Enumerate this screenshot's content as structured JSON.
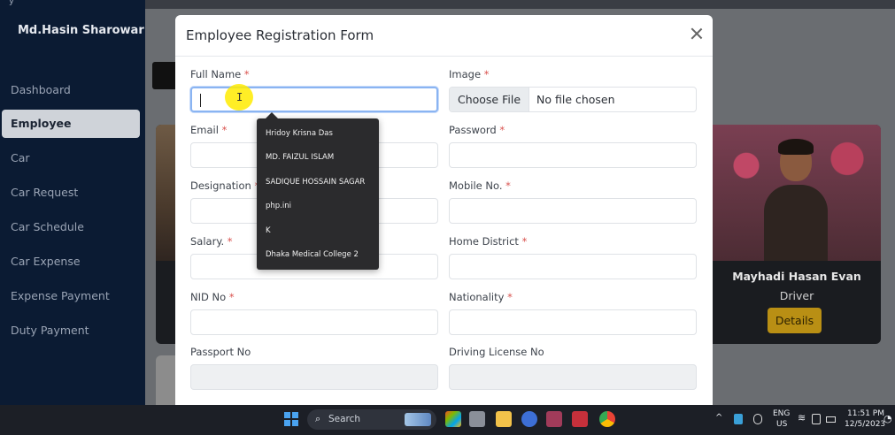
{
  "sidebar": {
    "user_name": "Md.Hasin Sharowar",
    "top_glyph": "y",
    "items": [
      {
        "label": "Dashboard"
      },
      {
        "label": "Employee"
      },
      {
        "label": "Car"
      },
      {
        "label": "Car Request"
      },
      {
        "label": "Car Schedule"
      },
      {
        "label": "Car Expense"
      },
      {
        "label": "Expense Payment"
      },
      {
        "label": "Duty Payment"
      }
    ],
    "active_item": "Employee"
  },
  "background_card": {
    "name": "Mayhadi Hasan Evan",
    "role": "Driver",
    "details_label": "Details"
  },
  "modal": {
    "title": "Employee Registration Form",
    "fields": {
      "full_name": {
        "label": "Full Name",
        "required": "*",
        "value": ""
      },
      "image": {
        "label": "Image",
        "required": "*",
        "button": "Choose File",
        "status": "No file chosen"
      },
      "email": {
        "label": "Email",
        "required": "*"
      },
      "password": {
        "label": "Password",
        "required": "*"
      },
      "designation": {
        "label": "Designation",
        "required": "*"
      },
      "mobile": {
        "label": "Mobile No.",
        "required": "*"
      },
      "salary": {
        "label": "Salary.",
        "required": "*"
      },
      "home_district": {
        "label": "Home District",
        "required": "*"
      },
      "nid": {
        "label": "NID No",
        "required": "*"
      },
      "nationality": {
        "label": "Nationality",
        "required": "*"
      },
      "passport": {
        "label": "Passport No"
      },
      "driving_license": {
        "label": "Driving License No"
      }
    }
  },
  "autocomplete": {
    "items": [
      "Hridoy Krisna Das",
      "MD. FAIZUL ISLAM",
      "SADIQUE HOSSAIN SAGAR",
      "php.ini",
      "K",
      "Dhaka Medical College 2"
    ]
  },
  "taskbar": {
    "search_label": "Search",
    "lang_line1": "ENG",
    "lang_line2": "US",
    "time": "11:51 PM",
    "date": "12/5/2023"
  },
  "colors": {
    "sidebar_bg": "#0b1b33",
    "details_button": "#b98f14",
    "required_mark": "#d9534f",
    "focus_border": "#8ab4f2"
  }
}
